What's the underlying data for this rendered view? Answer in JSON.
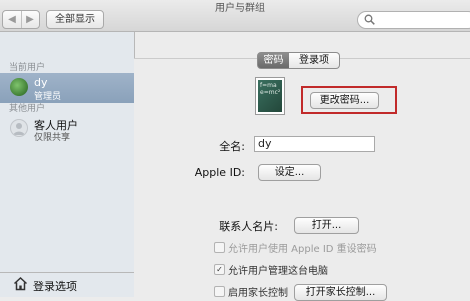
{
  "window": {
    "title": "用户与群组"
  },
  "toolbar": {
    "back_icon": "chevron-left-icon",
    "forward_icon": "chevron-right-icon",
    "show_all": "全部显示",
    "search_icon": "search-icon"
  },
  "sidebar": {
    "current_header": "当前用户",
    "current_user": {
      "name": "dy",
      "role": "管理员"
    },
    "other_header": "其他用户",
    "guest_user": {
      "name": "客人用户",
      "role": "仅限共享"
    },
    "login_options": "登录选项"
  },
  "tabs": {
    "password": "密码",
    "login_items": "登录项"
  },
  "picture": {
    "chalk_text": "f=ma e=mc²"
  },
  "buttons": {
    "change_password": "更改密码...",
    "setup": "设定...",
    "open": "打开...",
    "open_parental": "打开家长控制..."
  },
  "fields": {
    "full_name_label": "全名:",
    "full_name_value": "dy",
    "apple_id_label": "Apple ID:",
    "contact_card_label": "联系人名片:"
  },
  "checkboxes": {
    "reset_with_apple_id": "允许用户使用 Apple ID 重设密码",
    "allow_admin": "允许用户管理这台电脑",
    "enable_parental": "启用家长控制"
  },
  "colors": {
    "highlight": "#c12a2a",
    "selection": "#8aa1ba"
  }
}
